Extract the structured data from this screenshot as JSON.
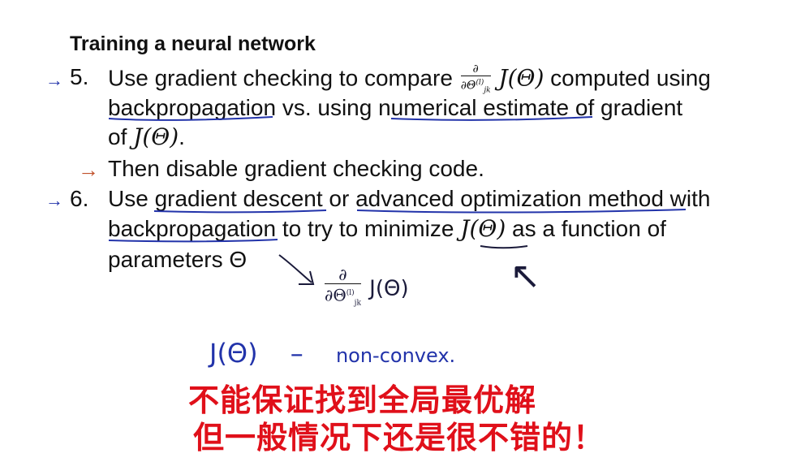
{
  "title": "Training a neural network",
  "step5": {
    "number": "5.",
    "line1_before": "Use gradient checking to compare",
    "frac_top": "∂",
    "frac_bottom": "∂Θ",
    "frac_sup": "(l)",
    "frac_sub": "jk",
    "line1_math": "J(Θ)",
    "line1_after": "computed using",
    "line2_a": "backpropagation",
    "line2_b": " vs. using ",
    "line2_c": "numerical estimate",
    "line2_d": " of gradient",
    "line3_a": "of ",
    "line3_math": "J(Θ)",
    "line3_b": ".",
    "sub_arrow": "→",
    "sub_text": "Then disable gradient checking code."
  },
  "step6": {
    "number": "6.",
    "line1_a": "Use ",
    "line1_b": "gradient descent",
    "line1_c": " or ",
    "line1_d": "advanced optimization method",
    "line1_e": " with",
    "line2_a": "backpropagation",
    "line2_b": " to try to  minimize ",
    "line2_math": "J(Θ)",
    "line2_c": " as a function of",
    "line3": "parameters Θ"
  },
  "handwritten": {
    "bullet_arrow": "→",
    "deriv_top": "∂",
    "deriv_bottom": "∂Θ",
    "deriv_sup": "(l)",
    "deriv_sub": "jk",
    "deriv_func": "J(Θ)",
    "upward_arrow": "↖",
    "nonconvex_func": "J(Θ)",
    "nonconvex_dash": "–",
    "nonconvex_text": "non-convex.",
    "chinese_line1": "不能保证找到全局最优解",
    "chinese_line2": "但一般情况下还是很不错的！"
  },
  "colors": {
    "text": "#111111",
    "blue_ink": "#2233aa",
    "red_ink": "#e0101a",
    "orange_arrow": "#c0502a"
  }
}
